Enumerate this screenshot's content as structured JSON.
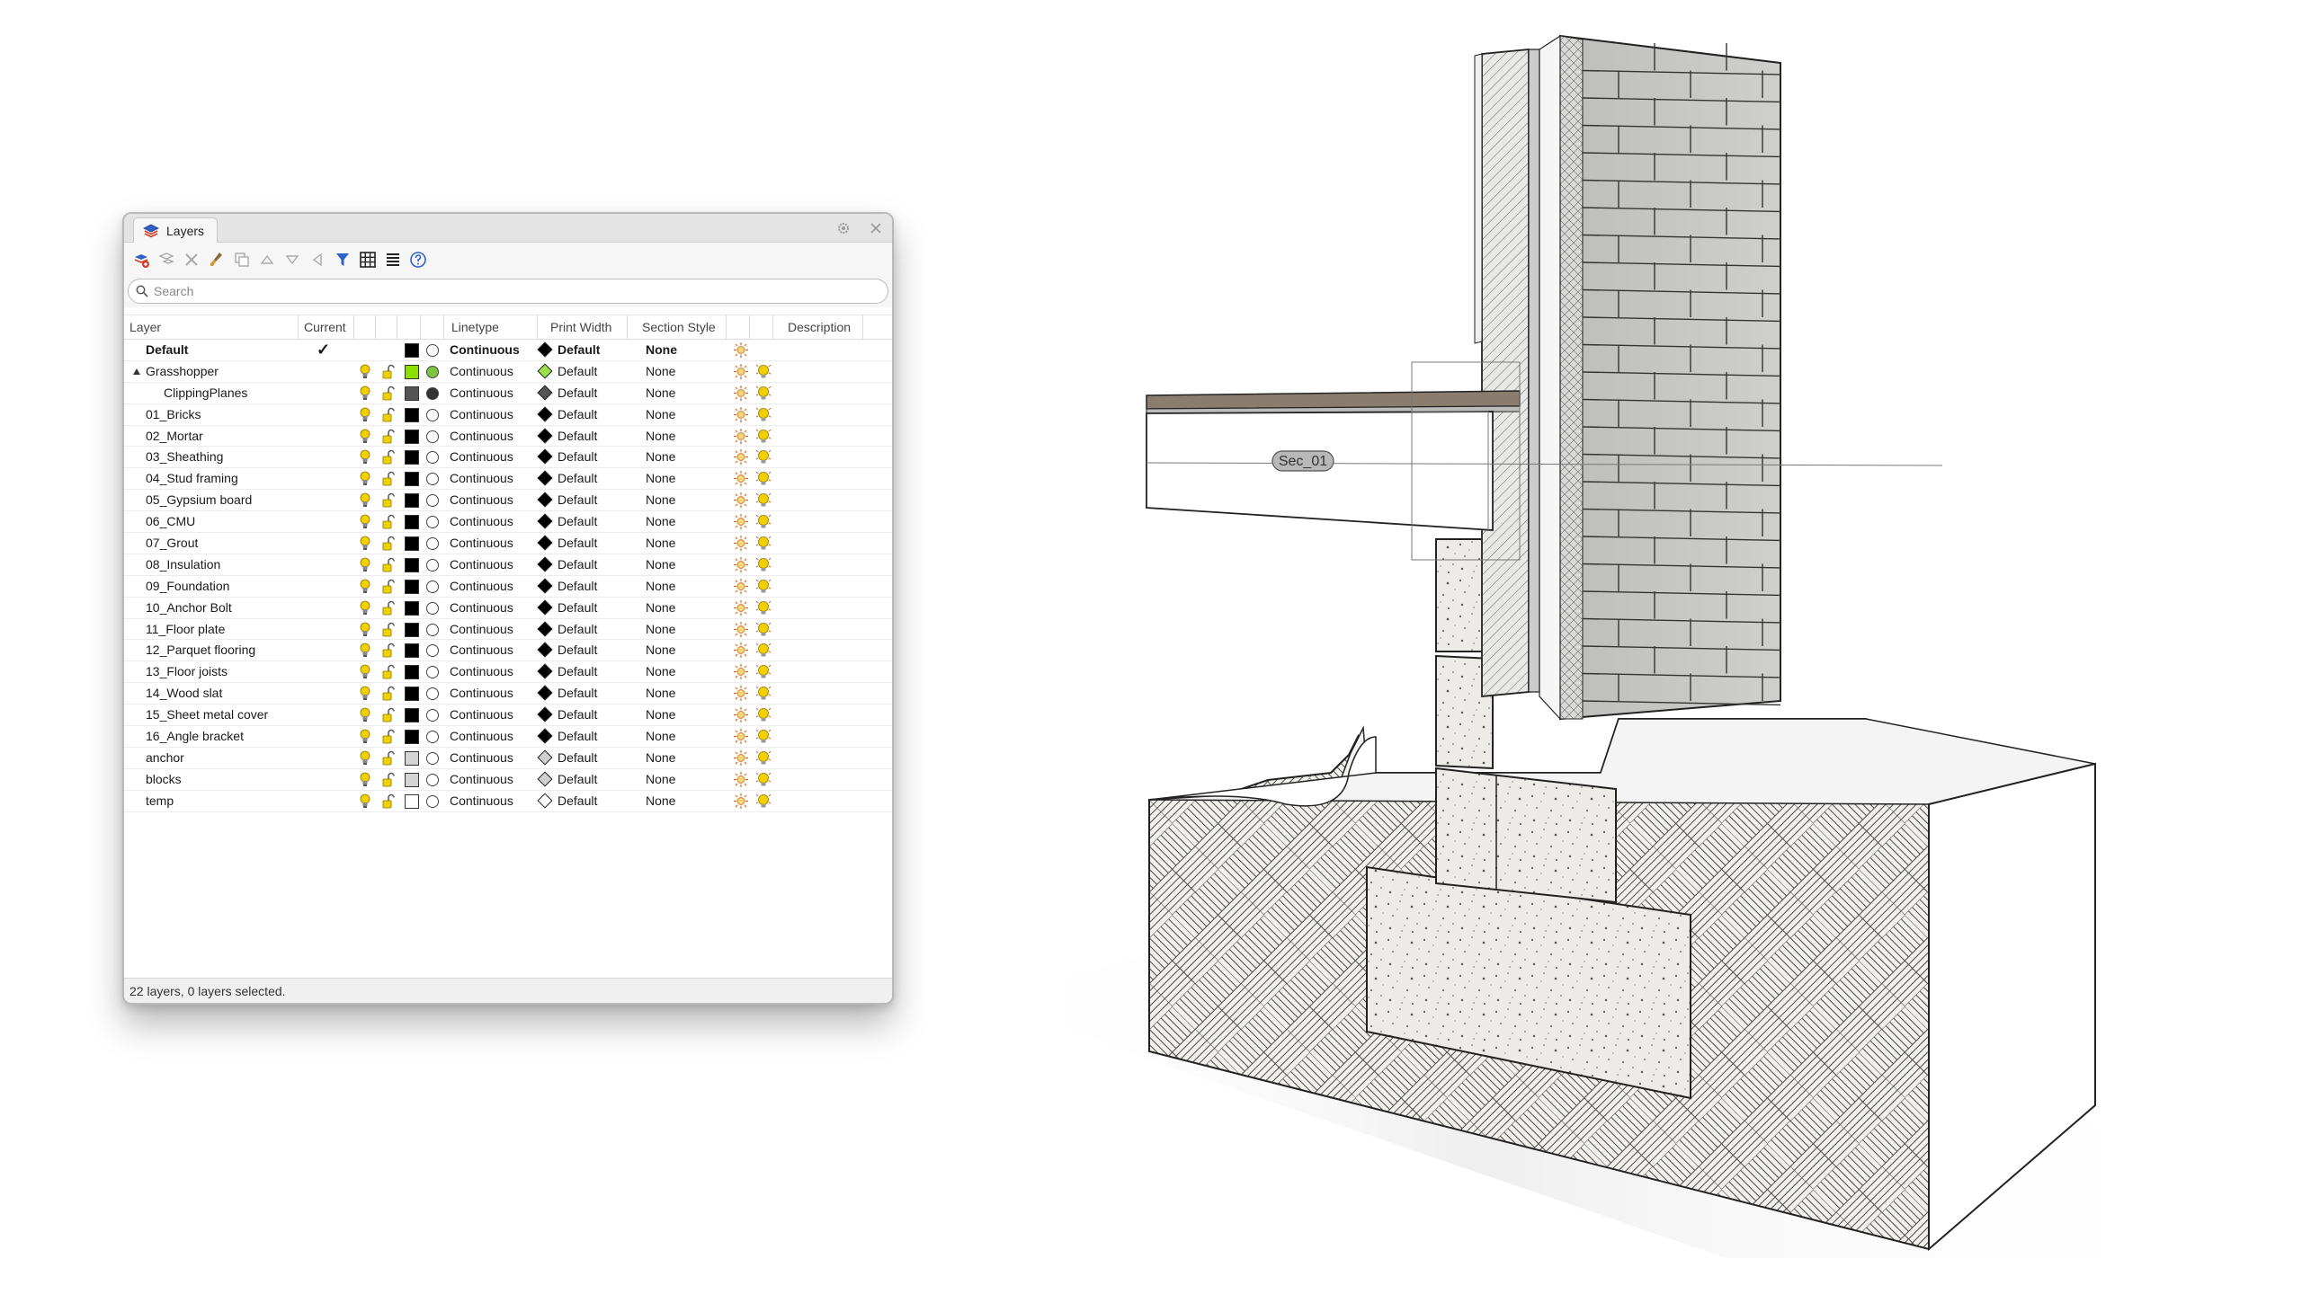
{
  "panel": {
    "tab_title": "Layers",
    "search_placeholder": "Search",
    "columns": {
      "layer": "Layer",
      "current": "Current",
      "linetype": "Linetype",
      "print_width": "Print Width",
      "section_style": "Section Style",
      "description": "Description"
    },
    "current_marker": "✓",
    "status": "22 layers, 0 layers selected."
  },
  "layers": [
    {
      "name": "Default",
      "linetype": "Continuous",
      "print_width": "Default",
      "section_style": "None",
      "color": "#000000",
      "current": true,
      "bold": true
    },
    {
      "name": "Grasshopper",
      "linetype": "Continuous",
      "print_width": "Default",
      "section_style": "None",
      "color": "#8be000",
      "expanded": true
    },
    {
      "name": "ClippingPlanes",
      "linetype": "Continuous",
      "print_width": "Default",
      "section_style": "None",
      "color": "#555555",
      "child": true
    },
    {
      "name": "01_Bricks",
      "linetype": "Continuous",
      "print_width": "Default",
      "section_style": "None",
      "color": "#000000"
    },
    {
      "name": "02_Mortar",
      "linetype": "Continuous",
      "print_width": "Default",
      "section_style": "None",
      "color": "#000000"
    },
    {
      "name": "03_Sheathing",
      "linetype": "Continuous",
      "print_width": "Default",
      "section_style": "None",
      "color": "#000000"
    },
    {
      "name": "04_Stud framing",
      "linetype": "Continuous",
      "print_width": "Default",
      "section_style": "None",
      "color": "#000000"
    },
    {
      "name": "05_Gypsium board",
      "linetype": "Continuous",
      "print_width": "Default",
      "section_style": "None",
      "color": "#000000"
    },
    {
      "name": "06_CMU",
      "linetype": "Continuous",
      "print_width": "Default",
      "section_style": "None",
      "color": "#000000"
    },
    {
      "name": "07_Grout",
      "linetype": "Continuous",
      "print_width": "Default",
      "section_style": "None",
      "color": "#000000"
    },
    {
      "name": "08_Insulation",
      "linetype": "Continuous",
      "print_width": "Default",
      "section_style": "None",
      "color": "#000000"
    },
    {
      "name": "09_Foundation",
      "linetype": "Continuous",
      "print_width": "Default",
      "section_style": "None",
      "color": "#000000"
    },
    {
      "name": "10_Anchor Bolt",
      "linetype": "Continuous",
      "print_width": "Default",
      "section_style": "None",
      "color": "#000000"
    },
    {
      "name": "11_Floor plate",
      "linetype": "Continuous",
      "print_width": "Default",
      "section_style": "None",
      "color": "#000000"
    },
    {
      "name": "12_Parquet flooring",
      "linetype": "Continuous",
      "print_width": "Default",
      "section_style": "None",
      "color": "#000000"
    },
    {
      "name": "13_Floor joists",
      "linetype": "Continuous",
      "print_width": "Default",
      "section_style": "None",
      "color": "#000000"
    },
    {
      "name": "14_Wood slat",
      "linetype": "Continuous",
      "print_width": "Default",
      "section_style": "None",
      "color": "#000000"
    },
    {
      "name": "15_Sheet metal cover",
      "linetype": "Continuous",
      "print_width": "Default",
      "section_style": "None",
      "color": "#000000"
    },
    {
      "name": "16_Angle bracket",
      "linetype": "Continuous",
      "print_width": "Default",
      "section_style": "None",
      "color": "#000000"
    },
    {
      "name": "anchor",
      "linetype": "Continuous",
      "print_width": "Default",
      "section_style": "None",
      "color": "#d4d4d4"
    },
    {
      "name": "blocks",
      "linetype": "Continuous",
      "print_width": "Default",
      "section_style": "None",
      "color": "#d4d4d4"
    },
    {
      "name": "temp",
      "linetype": "Continuous",
      "print_width": "Default",
      "section_style": "None",
      "color": "#ffffff"
    }
  ],
  "viewport": {
    "section_tag": "Sec_01"
  },
  "colors": {
    "accent": "#2a6fd6",
    "bulb": "#f2d000"
  }
}
